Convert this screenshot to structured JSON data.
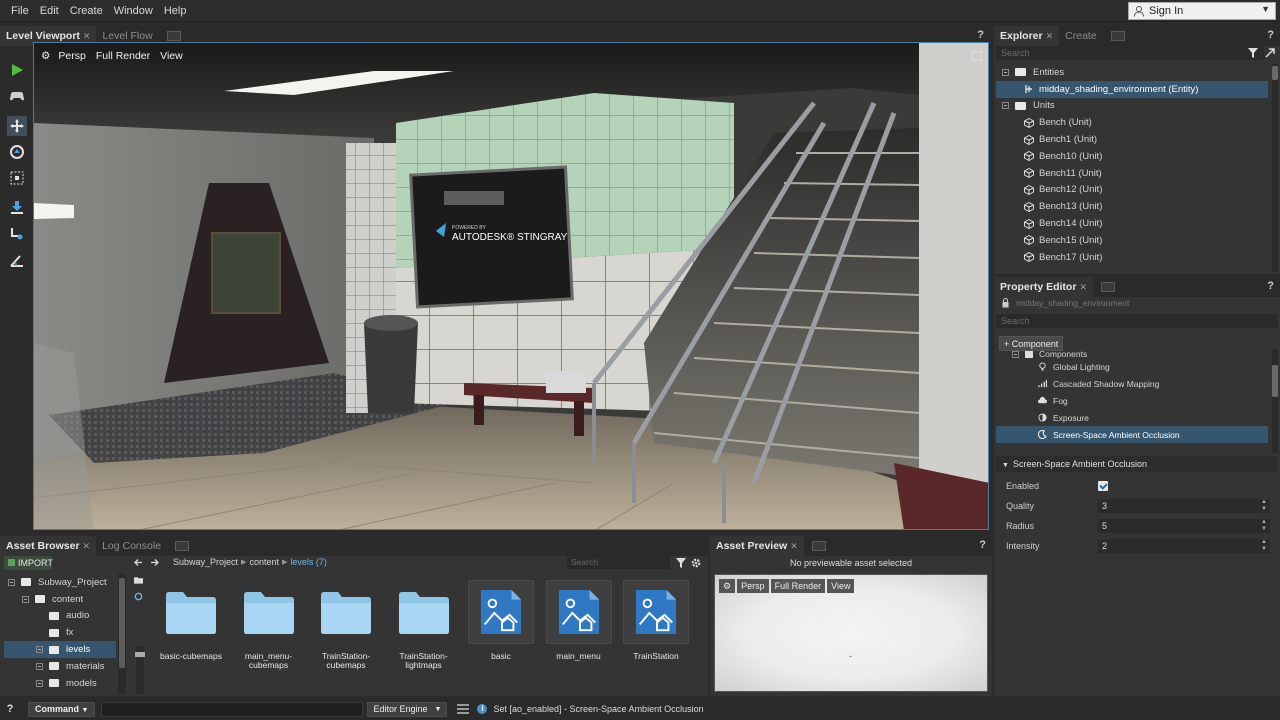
{
  "menu": [
    "File",
    "Edit",
    "Create",
    "Window",
    "Help"
  ],
  "signin": {
    "label": "Sign In"
  },
  "viewport": {
    "tabs": [
      {
        "label": "Level Viewport",
        "active": true,
        "closable": true
      },
      {
        "label": "Level Flow",
        "active": false,
        "closable": false
      }
    ],
    "help": "?",
    "bar": {
      "persp": "Persp",
      "render": "Full Render",
      "view": "View"
    },
    "tools": [
      "play-icon",
      "gamepad-icon",
      "move-icon",
      "rotate-icon",
      "scale-icon",
      "snap-down-icon",
      "pivot-icon",
      "angle-icon"
    ],
    "sign_text": {
      "powered": "POWERED BY",
      "brand": "AUTODESK® STINGRAY"
    }
  },
  "explorer": {
    "tabs": [
      {
        "label": "Explorer",
        "active": true
      },
      {
        "label": "Create",
        "active": false
      }
    ],
    "help": "?",
    "search_placeholder": "Search",
    "items": [
      {
        "label": "Entities",
        "kind": "group",
        "indent": 0
      },
      {
        "label": "midday_shading_environment (Entity)",
        "kind": "entity",
        "indent": 1,
        "selected": true
      },
      {
        "label": "Units",
        "kind": "group",
        "indent": 0
      },
      {
        "label": "Bench (Unit)",
        "kind": "unit",
        "indent": 1
      },
      {
        "label": "Bench1 (Unit)",
        "kind": "unit",
        "indent": 1
      },
      {
        "label": "Bench10 (Unit)",
        "kind": "unit",
        "indent": 1
      },
      {
        "label": "Bench11 (Unit)",
        "kind": "unit",
        "indent": 1
      },
      {
        "label": "Bench12 (Unit)",
        "kind": "unit",
        "indent": 1
      },
      {
        "label": "Bench13 (Unit)",
        "kind": "unit",
        "indent": 1
      },
      {
        "label": "Bench14 (Unit)",
        "kind": "unit",
        "indent": 1
      },
      {
        "label": "Bench15 (Unit)",
        "kind": "unit",
        "indent": 1
      },
      {
        "label": "Bench17 (Unit)",
        "kind": "unit",
        "indent": 1
      }
    ]
  },
  "property_editor": {
    "tab": "Property Editor",
    "help": "?",
    "entity_name": "midday_shading_environment",
    "search_placeholder": "Search",
    "component_button": "+ Component",
    "components_label": "Components",
    "components": [
      {
        "label": "Global Lighting",
        "icon": "bulb-icon"
      },
      {
        "label": "Cascaded Shadow Mapping",
        "icon": "bars-icon"
      },
      {
        "label": "Fog",
        "icon": "cloud-icon"
      },
      {
        "label": "Exposure",
        "icon": "half-circle-icon"
      },
      {
        "label": "Screen-Space Ambient Occlusion",
        "icon": "moon-icon",
        "selected": true
      }
    ],
    "section": "Screen-Space Ambient Occlusion",
    "fields": [
      {
        "key": "Enabled",
        "type": "checkbox",
        "value": true
      },
      {
        "key": "Quality",
        "type": "number",
        "value": "3"
      },
      {
        "key": "Radius",
        "type": "number",
        "value": "5"
      },
      {
        "key": "Intensity",
        "type": "number",
        "value": "2"
      }
    ]
  },
  "asset_browser": {
    "tabs": [
      {
        "label": "Asset Browser",
        "active": true
      },
      {
        "label": "Log Console",
        "active": false
      }
    ],
    "import": "IMPORT",
    "breadcrumb": {
      "root": "Subway_Project",
      "mid": "content",
      "current": "levels (7)"
    },
    "search_placeholder": "Search",
    "tree": [
      {
        "label": "Subway_Project",
        "indent": 0
      },
      {
        "label": "content",
        "indent": 1
      },
      {
        "label": "audio",
        "indent": 2
      },
      {
        "label": "fx",
        "indent": 2
      },
      {
        "label": "levels",
        "indent": 2,
        "selected": true
      },
      {
        "label": "materials",
        "indent": 2
      },
      {
        "label": "models",
        "indent": 2
      }
    ],
    "assets": [
      {
        "label": "basic-cubemaps",
        "type": "folder"
      },
      {
        "label": "main_menu-cubemaps",
        "type": "folder"
      },
      {
        "label": "TrainStation-cubemaps",
        "type": "folder"
      },
      {
        "label": "TrainStation-lightmaps",
        "type": "folder"
      },
      {
        "label": "basic",
        "type": "level"
      },
      {
        "label": "main_menu",
        "type": "level"
      },
      {
        "label": "TrainStation",
        "type": "level"
      }
    ]
  },
  "asset_preview": {
    "tab": "Asset Preview",
    "help": "?",
    "message": "No previewable asset selected",
    "bar": {
      "persp": "Persp",
      "render": "Full Render",
      "view": "View"
    },
    "center_mark": "-"
  },
  "command_bar": {
    "help": "?",
    "command_label": "Command",
    "engine": "Editor Engine",
    "status": "Set [ao_enabled] - Screen-Space Ambient Occlusion"
  },
  "colors": {
    "accent": "#36566f",
    "viewport_border": "#4b7da3",
    "link": "#6fb3e6"
  }
}
